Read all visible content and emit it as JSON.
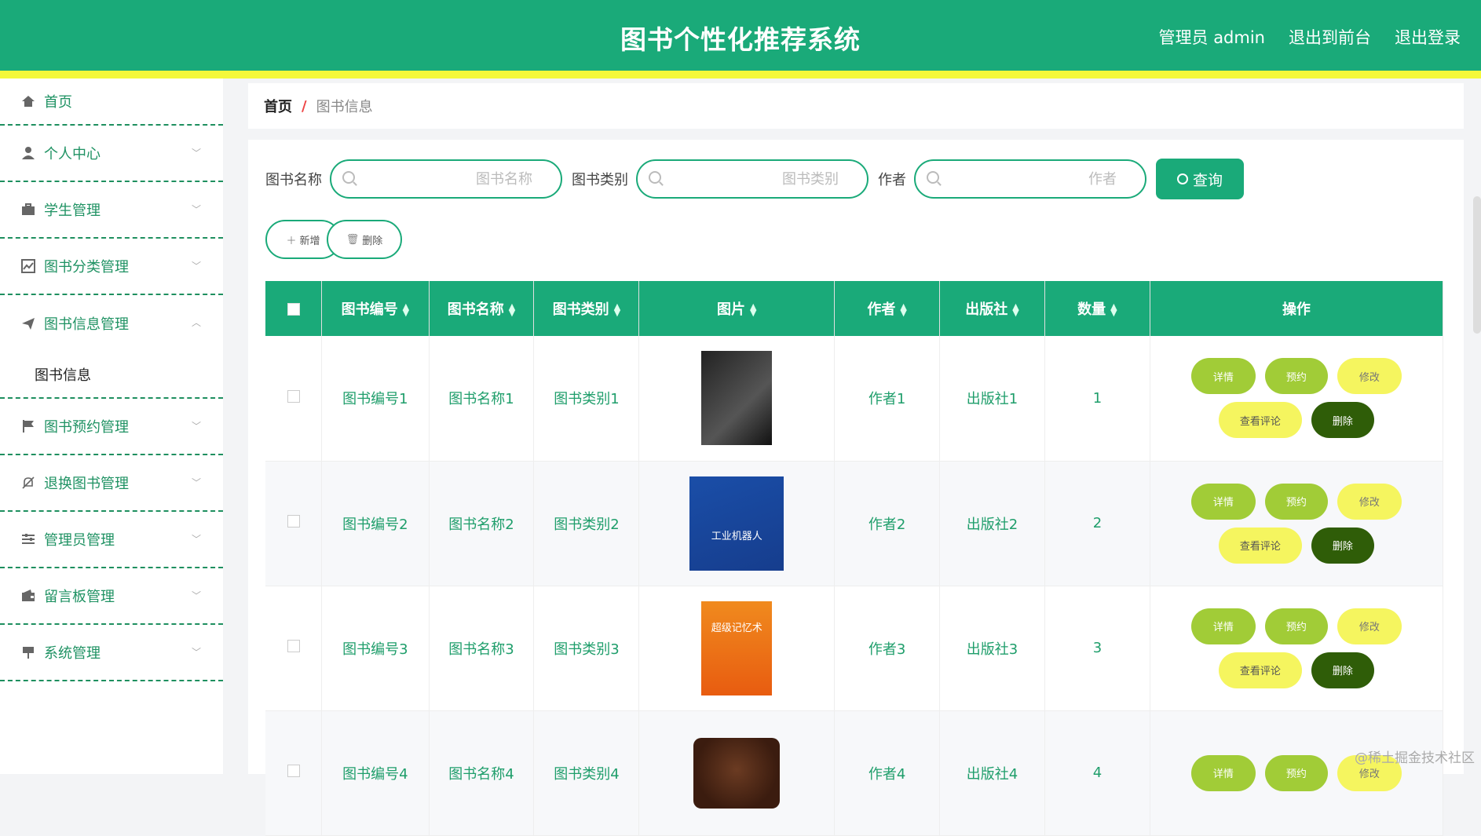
{
  "header": {
    "title": "图书个性化推荐系统",
    "admin": "管理员 admin",
    "to_front": "退出到前台",
    "logout": "退出登录"
  },
  "sidebar": {
    "items": [
      {
        "label": "首页",
        "icon": "home-icon"
      },
      {
        "label": "个人中心",
        "icon": "user-icon"
      },
      {
        "label": "学生管理",
        "icon": "briefcase-icon"
      },
      {
        "label": "图书分类管理",
        "icon": "chart-icon"
      },
      {
        "label": "图书信息管理",
        "icon": "send-icon"
      },
      {
        "label": "图书预约管理",
        "icon": "flag-icon"
      },
      {
        "label": "退换图书管理",
        "icon": "bell-off-icon"
      },
      {
        "label": "管理员管理",
        "icon": "sliders-icon"
      },
      {
        "label": "留言板管理",
        "icon": "wallet-icon"
      },
      {
        "label": "系统管理",
        "icon": "flag-pole-icon"
      }
    ],
    "submenu_label": "图书信息"
  },
  "breadcrumb": {
    "home": "首页",
    "current": "图书信息"
  },
  "search": {
    "name_label": "图书名称",
    "name_placeholder": "图书名称",
    "category_label": "图书类别",
    "category_placeholder": "图书类别",
    "author_label": "作者",
    "author_placeholder": "作者",
    "query_label": "查询"
  },
  "actions": {
    "add_label": "新增",
    "delete_label": "删除"
  },
  "table": {
    "headers": [
      "图书编号",
      "图书名称",
      "图书类别",
      "图片",
      "作者",
      "出版社",
      "数量",
      "操作"
    ],
    "rows": [
      {
        "id": "图书编号1",
        "name": "图书名称1",
        "category": "图书类别1",
        "author": "作者1",
        "publisher": "出版社1",
        "qty": "1"
      },
      {
        "id": "图书编号2",
        "name": "图书名称2",
        "category": "图书类别2",
        "author": "作者2",
        "publisher": "出版社2",
        "qty": "2"
      },
      {
        "id": "图书编号3",
        "name": "图书名称3",
        "category": "图书类别3",
        "author": "作者3",
        "publisher": "出版社3",
        "qty": "3"
      },
      {
        "id": "图书编号4",
        "name": "图书名称4",
        "category": "图书类别4",
        "author": "作者4",
        "publisher": "出版社4",
        "qty": "4"
      }
    ],
    "ops": {
      "detail": "详情",
      "reserve": "预约",
      "edit": "修改",
      "review": "查看评论",
      "delete": "删除"
    }
  },
  "covers": {
    "cover2_title": "工业机器人",
    "cover3_title": "超级记忆术"
  },
  "watermark": "@稀土掘金技术社区",
  "colors": {
    "primary": "#1aaa79",
    "accent_yellow": "#f4f83a",
    "lime": "#a1cc37",
    "dark_green": "#2f5d08"
  }
}
